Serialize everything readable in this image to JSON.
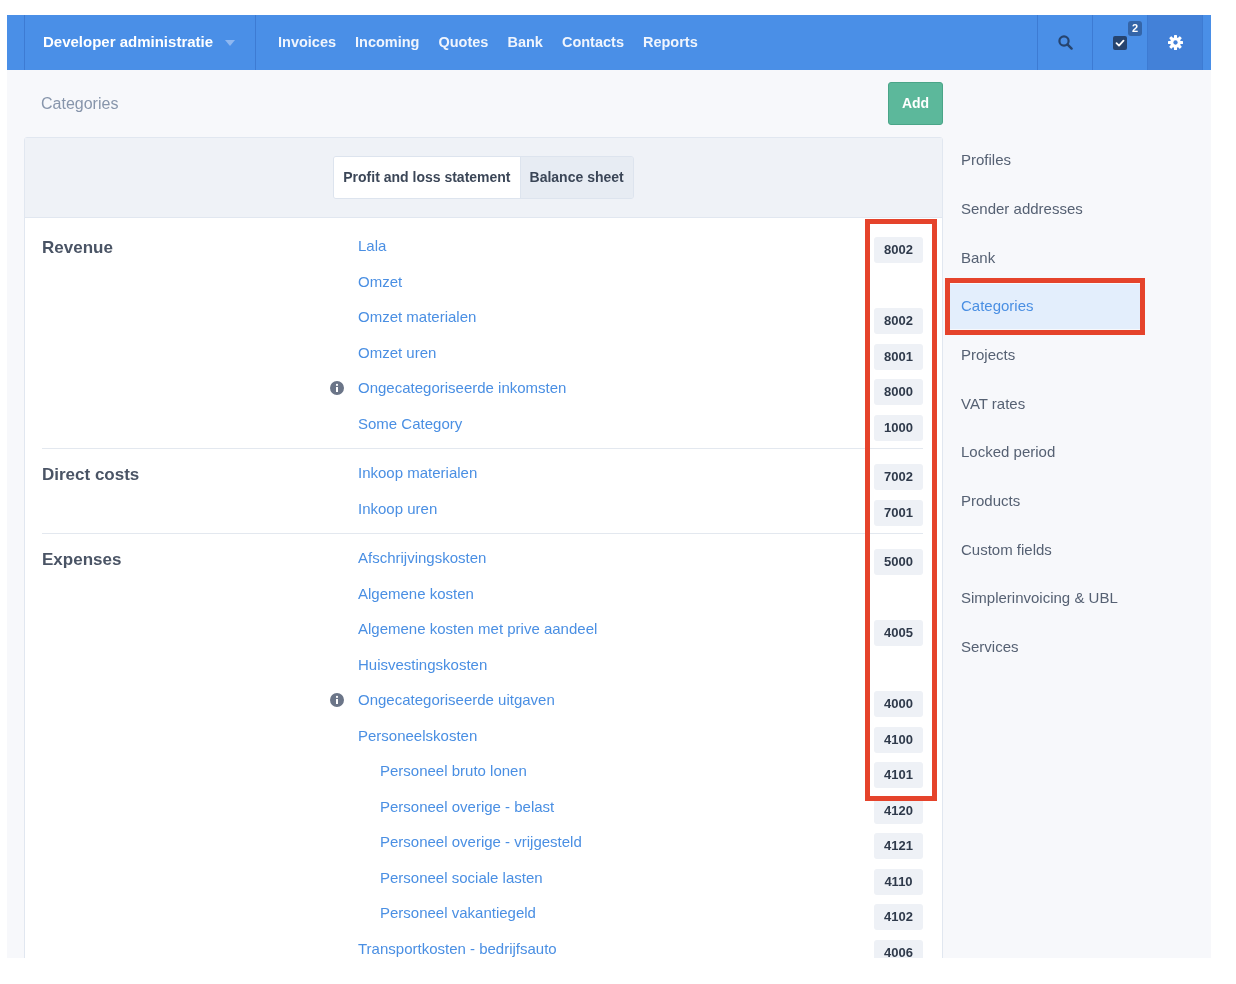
{
  "top_nav": {
    "brand": "Developer administratie",
    "links": [
      "Invoices",
      "Incoming",
      "Quotes",
      "Bank",
      "Contacts",
      "Reports"
    ],
    "toolbar": [
      {
        "kind": "search",
        "selected": false
      },
      {
        "kind": "tasks",
        "selected": false,
        "badge": "2"
      },
      {
        "kind": "settings",
        "selected": true
      }
    ]
  },
  "page_header": {
    "title": "Categories",
    "add_button": "Add"
  },
  "statement_tabs": [
    {
      "label": "Profit and loss statement",
      "selected": true
    },
    {
      "label": "Balance sheet",
      "selected": false
    }
  ],
  "code_column_framed": true,
  "groups": [
    {
      "title": "Revenue",
      "categories": [
        {
          "name": "Lala",
          "code": "8002",
          "info": false
        },
        {
          "name": "Omzet",
          "info": false
        },
        {
          "name": "Omzet materialen",
          "code": "8002",
          "info": false
        },
        {
          "name": "Omzet uren",
          "code": "8001",
          "info": false
        },
        {
          "name": "Ongecategoriseerde inkomsten",
          "code": "8000",
          "info": true
        },
        {
          "name": "Some Category",
          "code": "1000",
          "info": false
        }
      ]
    },
    {
      "title": "Direct costs",
      "categories": [
        {
          "name": "Inkoop materialen",
          "code": "7002",
          "info": false
        },
        {
          "name": "Inkoop uren",
          "code": "7001",
          "info": false
        }
      ]
    },
    {
      "title": "Expenses",
      "categories": [
        {
          "name": "Afschrijvingskosten",
          "code": "5000",
          "info": false
        },
        {
          "name": "Algemene kosten",
          "info": false
        },
        {
          "name": "Algemene kosten met prive aandeel",
          "code": "4005",
          "info": false
        },
        {
          "name": "Huisvestingskosten",
          "info": false
        },
        {
          "name": "Ongecategoriseerde uitgaven",
          "code": "4000",
          "info": true
        },
        {
          "name": "Personeelskosten",
          "code": "4100",
          "info": false,
          "children": [
            {
              "name": "Personeel bruto lonen",
              "code": "4101",
              "info": false
            },
            {
              "name": "Personeel overige - belast",
              "code": "4120",
              "info": false
            },
            {
              "name": "Personeel overige - vrijgesteld",
              "code": "4121",
              "info": false
            },
            {
              "name": "Personeel sociale lasten",
              "code": "4110",
              "info": false
            },
            {
              "name": "Personeel vakantiegeld",
              "code": "4102",
              "info": false
            }
          ]
        },
        {
          "name": "Transportkosten - bedrijfsauto",
          "code": "4006",
          "info": false
        }
      ]
    }
  ],
  "settings_menu": [
    {
      "label": "Profiles",
      "selected": false,
      "framed": false
    },
    {
      "label": "Sender addresses",
      "selected": false,
      "framed": false
    },
    {
      "label": "Bank",
      "selected": false,
      "framed": false
    },
    {
      "label": "Categories",
      "selected": true,
      "framed": true
    },
    {
      "label": "Projects",
      "selected": false,
      "framed": false
    },
    {
      "label": "VAT rates",
      "selected": false,
      "framed": false
    },
    {
      "label": "Locked period",
      "selected": false,
      "framed": false
    },
    {
      "label": "Products",
      "selected": false,
      "framed": false
    },
    {
      "label": "Custom fields",
      "selected": false,
      "framed": false
    },
    {
      "label": "Simplerinvoicing & UBL",
      "selected": false,
      "framed": false
    },
    {
      "label": "Services",
      "selected": false,
      "framed": false
    }
  ]
}
